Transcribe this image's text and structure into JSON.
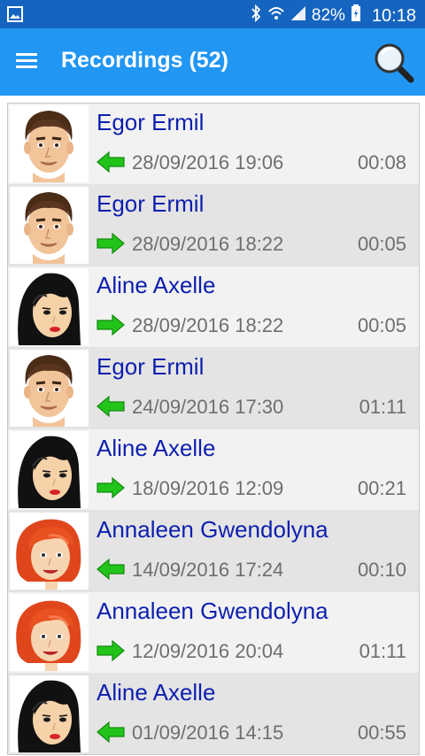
{
  "status_bar": {
    "battery": "82%",
    "time": "10:18",
    "icons": [
      "image-icon",
      "bluetooth-icon",
      "wifi-icon",
      "signal-icon",
      "battery-icon"
    ]
  },
  "app_bar": {
    "title": "Recordings (52)",
    "menu_icon": "hamburger-menu-icon",
    "search_icon": "magnifier-search-icon",
    "color": "#2196f3"
  },
  "recordings": [
    {
      "name": "Egor Ermil",
      "direction": "incoming",
      "datetime": "28/09/2016 19:06",
      "duration": "00:08",
      "avatar": "man-brown-hair"
    },
    {
      "name": "Egor Ermil",
      "direction": "outgoing",
      "datetime": "28/09/2016 18:22",
      "duration": "00:05",
      "avatar": "man-brown-hair"
    },
    {
      "name": "Aline Axelle",
      "direction": "outgoing",
      "datetime": "28/09/2016 18:22",
      "duration": "00:05",
      "avatar": "woman-black-hair"
    },
    {
      "name": "Egor Ermil",
      "direction": "incoming",
      "datetime": "24/09/2016 17:30",
      "duration": "01:11",
      "avatar": "man-brown-hair"
    },
    {
      "name": "Aline Axelle",
      "direction": "outgoing",
      "datetime": "18/09/2016 12:09",
      "duration": "00:21",
      "avatar": "woman-black-hair"
    },
    {
      "name": "Annaleen Gwendolyna",
      "direction": "incoming",
      "datetime": "14/09/2016 17:24",
      "duration": "00:10",
      "avatar": "woman-red-hair"
    },
    {
      "name": "Annaleen Gwendolyna",
      "direction": "outgoing",
      "datetime": "12/09/2016 20:04",
      "duration": "01:11",
      "avatar": "woman-red-hair"
    },
    {
      "name": "Aline Axelle",
      "direction": "incoming",
      "datetime": "01/09/2016 14:15",
      "duration": "00:55",
      "avatar": "woman-black-hair"
    }
  ],
  "colors": {
    "name_text": "#0d1fae",
    "arrow_green": "#22c41a",
    "row_light": "#f2f2f2",
    "row_dark": "#e4e4e4"
  }
}
